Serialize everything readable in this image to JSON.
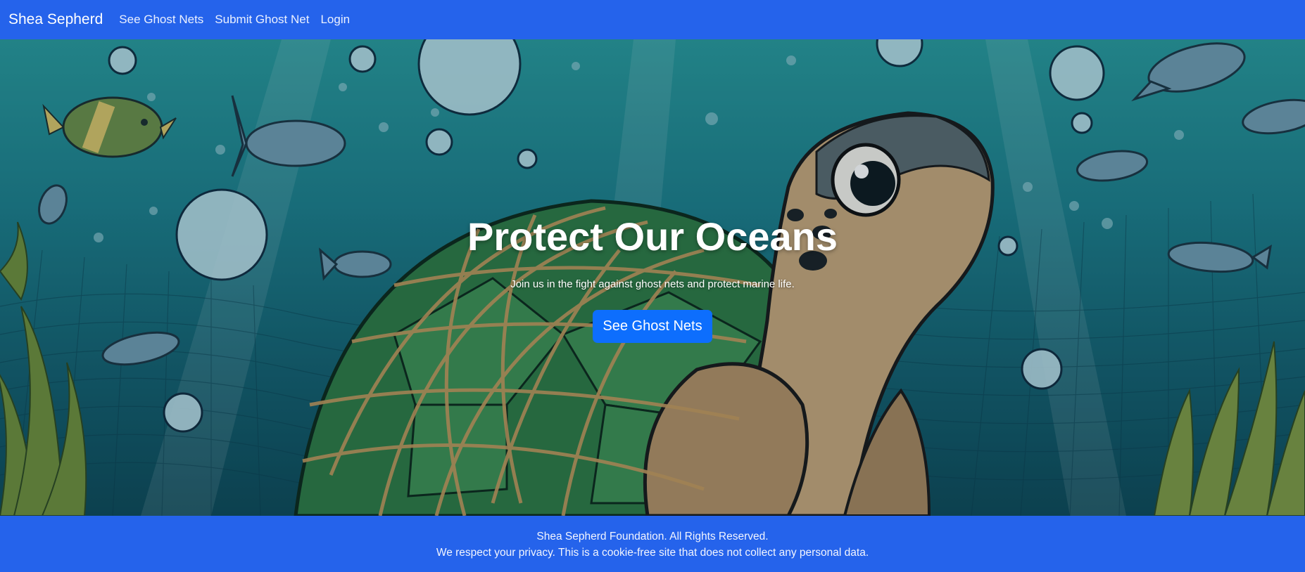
{
  "navbar": {
    "brand": "Shea Sepherd",
    "links": [
      {
        "label": "See Ghost Nets"
      },
      {
        "label": "Submit Ghost Net"
      },
      {
        "label": "Login"
      }
    ]
  },
  "hero": {
    "title": "Protect Our Oceans",
    "subtitle": "Join us in the fight against ghost nets and protect marine life.",
    "button_label": "See Ghost Nets",
    "background_icon": "sea-turtle-in-ghost-net-illustration"
  },
  "footer": {
    "copyright": "Shea Sepherd Foundation. All Rights Reserved.",
    "privacy": "We respect your privacy. This is a cookie-free site that does not collect any personal data."
  },
  "colors": {
    "navbar": "#2563eb",
    "footer": "#2563eb",
    "button": "#0d6efd",
    "ocean_top": "#2a9a9c",
    "ocean_bottom": "#0f4a58"
  }
}
